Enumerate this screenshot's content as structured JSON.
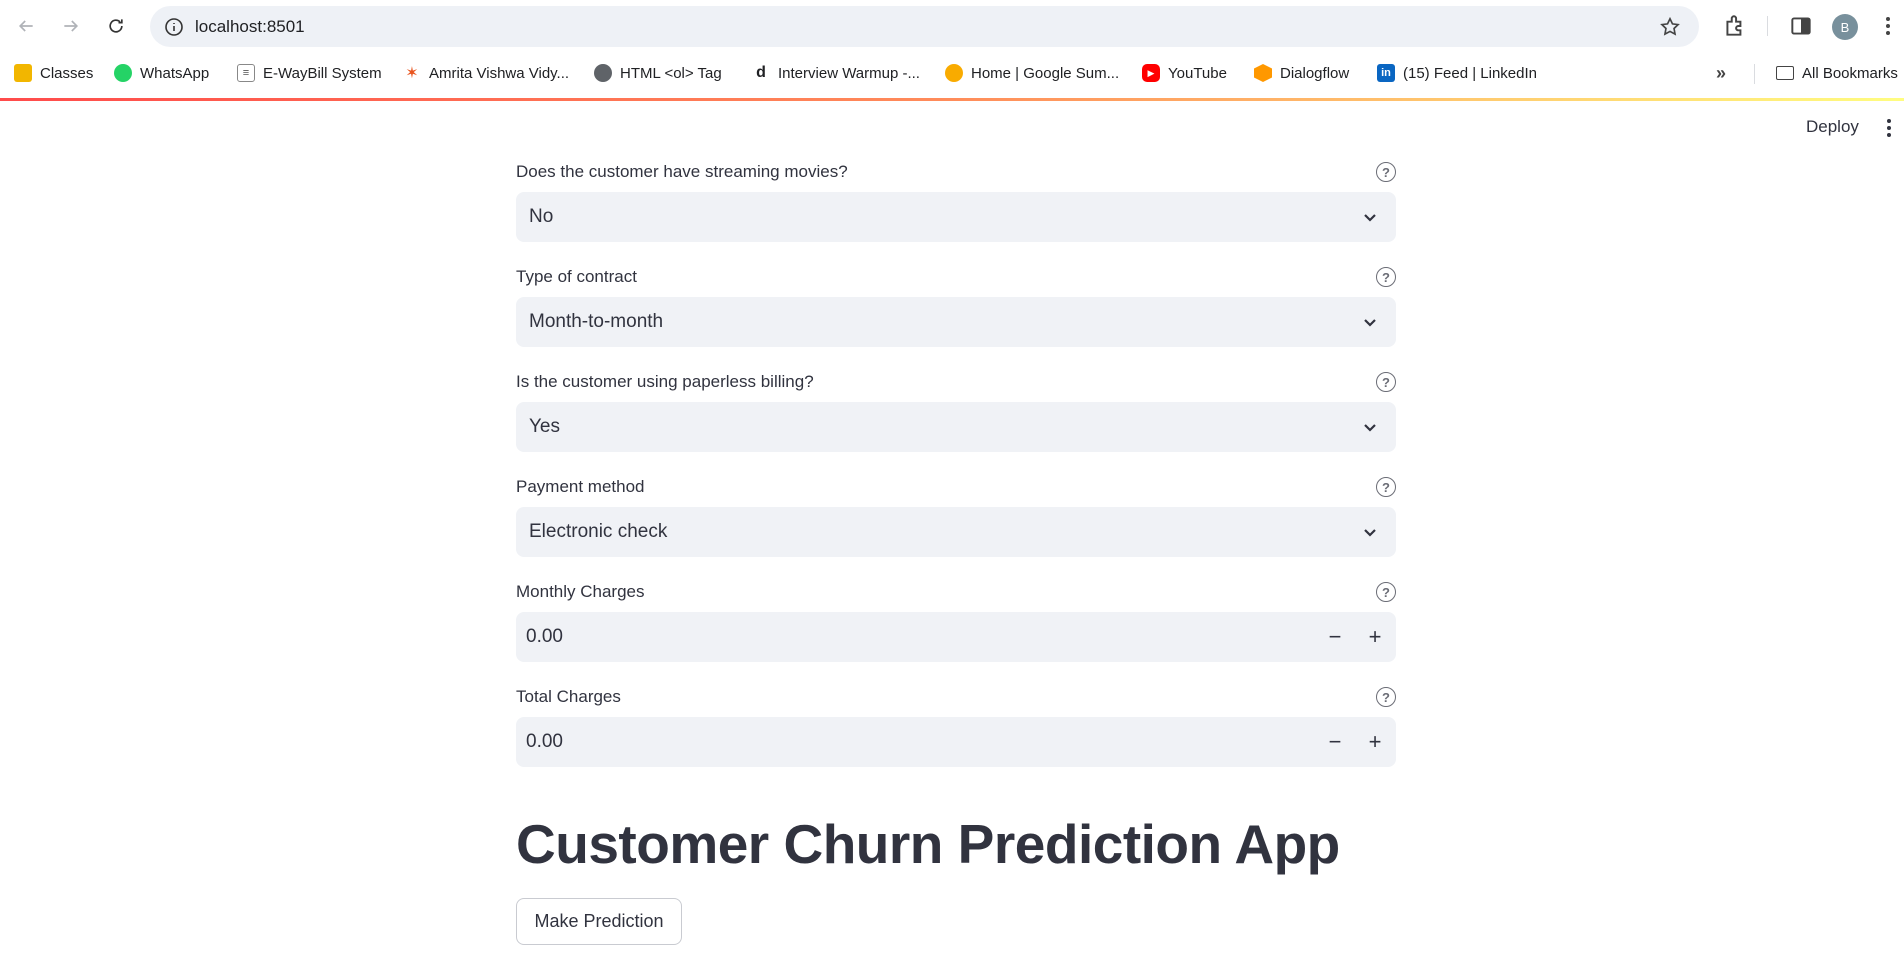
{
  "browser": {
    "url": "localhost:8501",
    "avatar_letter": "B",
    "bookmarks": [
      {
        "label": "Classes",
        "icon": "google-classroom-icon"
      },
      {
        "label": "WhatsApp",
        "icon": "whatsapp-icon"
      },
      {
        "label": "E-WayBill System",
        "icon": "ewaybill-icon"
      },
      {
        "label": "Amrita Vishwa Vidy...",
        "icon": "amrita-icon"
      },
      {
        "label": "HTML <ol> Tag",
        "icon": "globe-icon"
      },
      {
        "label": "Interview Warmup -...",
        "icon": "d-icon"
      },
      {
        "label": "Home | Google Sum...",
        "icon": "google-summer-icon"
      },
      {
        "label": "YouTube",
        "icon": "youtube-icon"
      },
      {
        "label": "Dialogflow",
        "icon": "dialogflow-icon"
      },
      {
        "label": "(15) Feed | LinkedIn",
        "icon": "linkedin-icon"
      }
    ],
    "all_bookmarks_label": "All Bookmarks"
  },
  "header": {
    "deploy_label": "Deploy"
  },
  "form": {
    "streaming_movies": {
      "label": "Does the customer have streaming movies?",
      "value": "No"
    },
    "contract": {
      "label": "Type of contract",
      "value": "Month-to-month"
    },
    "paperless": {
      "label": "Is the customer using paperless billing?",
      "value": "Yes"
    },
    "payment": {
      "label": "Payment method",
      "value": "Electronic check"
    },
    "monthly": {
      "label": "Monthly Charges",
      "value": "0.00"
    },
    "total": {
      "label": "Total Charges",
      "value": "0.00"
    }
  },
  "main": {
    "title": "Customer Churn Prediction App",
    "predict_label": "Make Prediction"
  },
  "colors": {
    "accent": "#ff4b4b",
    "text": "#31333f",
    "input_bg": "#f0f2f6"
  }
}
